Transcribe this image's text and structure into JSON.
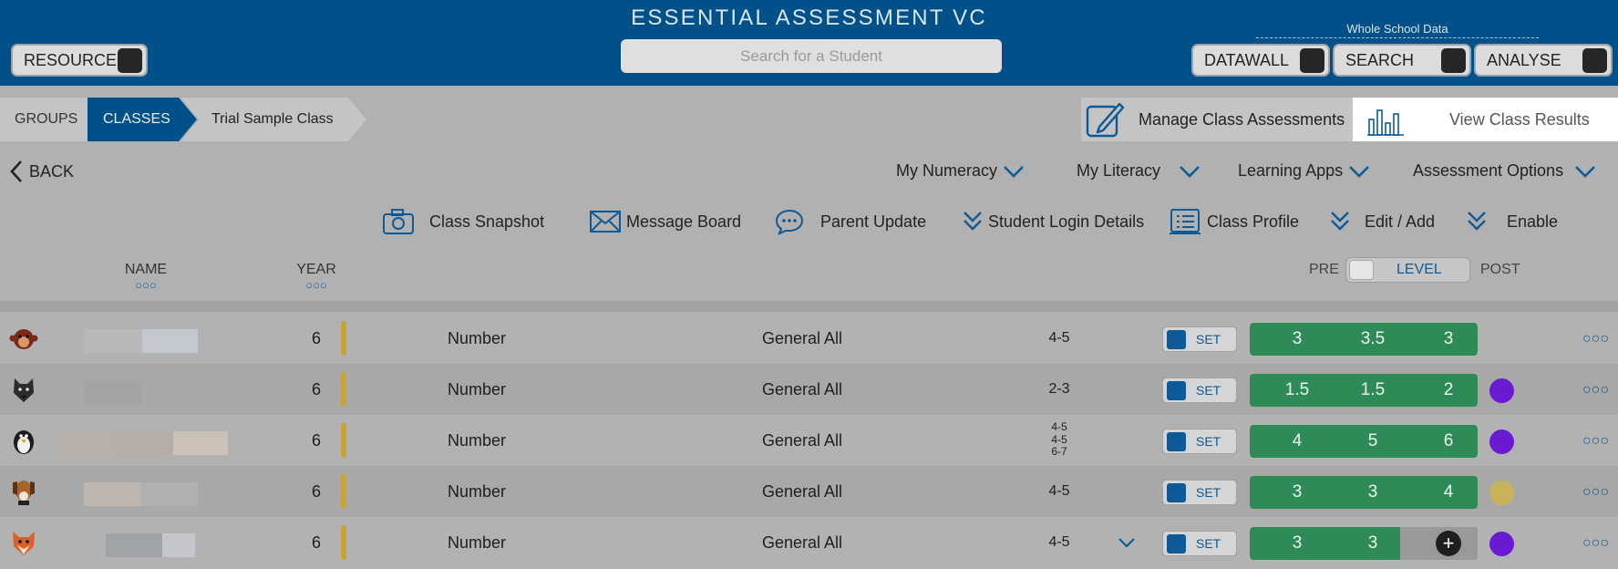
{
  "header": {
    "title": "ESSENTIAL ASSESSMENT VC",
    "resources_label": "RESOURCES",
    "search_placeholder": "Search for a Student",
    "whole_school_label": "Whole School Data",
    "datawall_label": "DATAWALL",
    "search_label": "SEARCH",
    "analyse_label": "ANALYSE"
  },
  "breadcrumb": {
    "groups": "GROUPS",
    "classes": "CLASSES",
    "current": "Trial Sample Class"
  },
  "actions": {
    "manage": "Manage Class Assessments",
    "view_results": "View Class Results"
  },
  "nav": {
    "back": "BACK",
    "menus": [
      "My Numeracy",
      "My Literacy",
      "Learning Apps",
      "Assessment Options"
    ]
  },
  "toolbar": {
    "snapshot": "Class Snapshot",
    "message_board": "Message Board",
    "parent_update": "Parent Update",
    "student_login": "Student Login Details",
    "class_profile": "Class Profile",
    "edit_add": "Edit / Add",
    "enable": "Enable"
  },
  "table": {
    "name_header": "NAME",
    "year_header": "YEAR",
    "toggle": {
      "pre": "PRE",
      "level": "LEVEL",
      "post": "POST"
    },
    "set_label": "SET",
    "rows": [
      {
        "avatar": "monkey",
        "year": "6",
        "strand": "Number",
        "assessment": "General All",
        "levels": [
          "4-5"
        ],
        "scores": [
          "3",
          "3.5",
          "3"
        ],
        "status_color": ""
      },
      {
        "avatar": "wolf",
        "year": "6",
        "strand": "Number",
        "assessment": "General All",
        "levels": [
          "2-3"
        ],
        "scores": [
          "1.5",
          "1.5",
          "2"
        ],
        "status_color": "#6a1ad0"
      },
      {
        "avatar": "penguin",
        "year": "6",
        "strand": "Number",
        "assessment": "General All",
        "levels": [
          "4-5",
          "4-5",
          "6-7"
        ],
        "scores": [
          "4",
          "5",
          "6"
        ],
        "status_color": "#6a1ad0"
      },
      {
        "avatar": "dog",
        "year": "6",
        "strand": "Number",
        "assessment": "General All",
        "levels": [
          "4-5"
        ],
        "scores": [
          "3",
          "3",
          "4"
        ],
        "status_color": "#c8b25a"
      },
      {
        "avatar": "fox",
        "year": "6",
        "strand": "Number",
        "assessment": "General All",
        "levels": [
          "4-5"
        ],
        "scores": [
          "3",
          "3",
          "+"
        ],
        "status_color": "#6a1ad0"
      }
    ]
  },
  "colors": {
    "brand_blue": "#00508a",
    "score_green": "#2e8a56",
    "accent_blue": "#0d5a96"
  }
}
